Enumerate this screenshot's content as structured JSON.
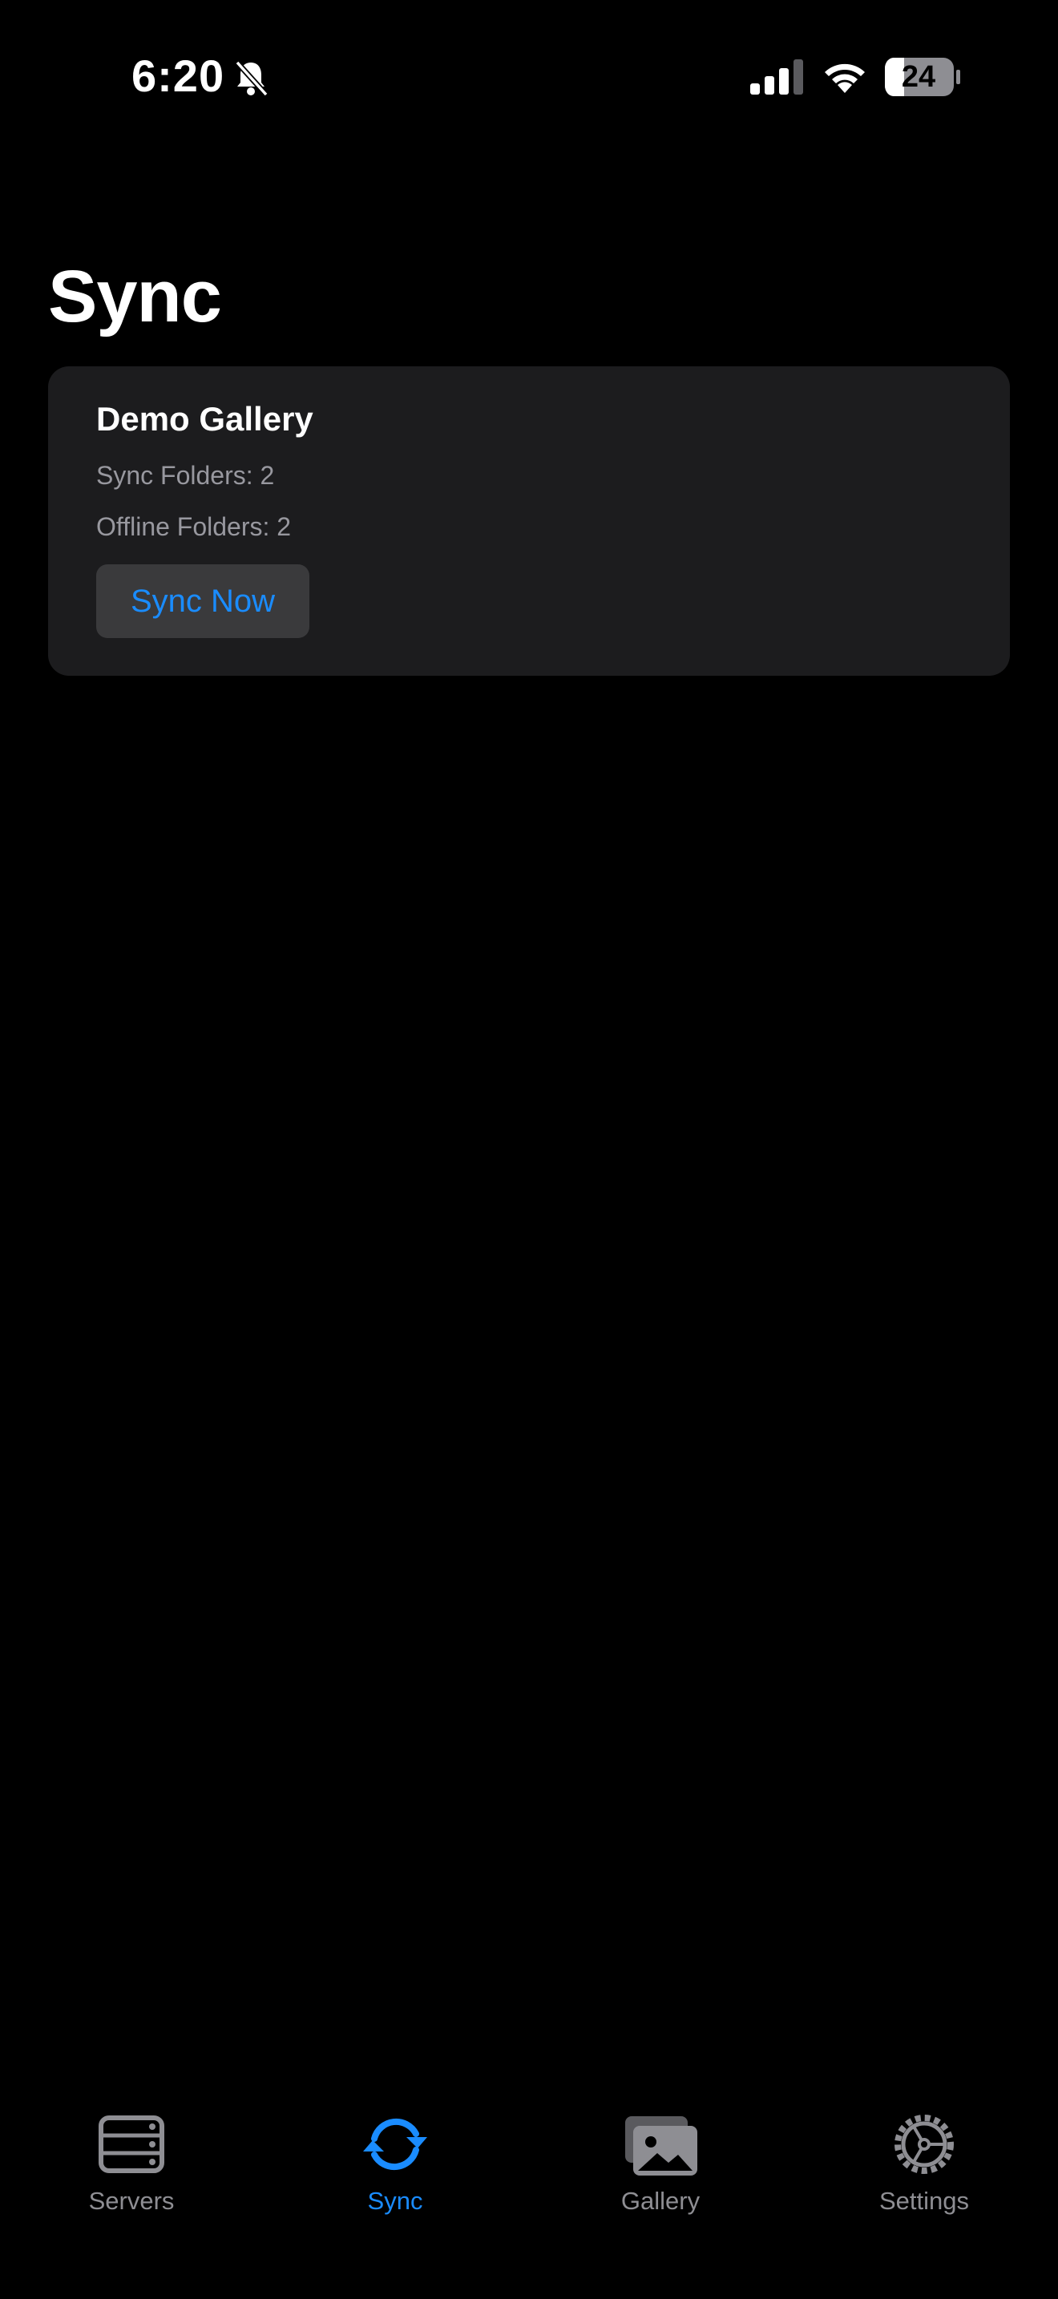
{
  "status_bar": {
    "time": "6:20",
    "battery_level": "24"
  },
  "page": {
    "title": "Sync"
  },
  "card": {
    "title": "Demo Gallery",
    "sync_folders": "Sync Folders: 2",
    "offline_folders": "Offline Folders: 2",
    "sync_now_label": "Sync Now"
  },
  "tab_bar": {
    "tabs": [
      {
        "label": "Servers",
        "icon": "servers-icon",
        "active": false
      },
      {
        "label": "Sync",
        "icon": "sync-icon",
        "active": true
      },
      {
        "label": "Gallery",
        "icon": "gallery-icon",
        "active": false
      },
      {
        "label": "Settings",
        "icon": "settings-icon",
        "active": false
      }
    ]
  },
  "colors": {
    "accent": "#1a8cff",
    "background": "#000000",
    "card": "#1c1c1e",
    "secondary_text": "#98989f",
    "inactive_tab": "#8e8e93"
  }
}
